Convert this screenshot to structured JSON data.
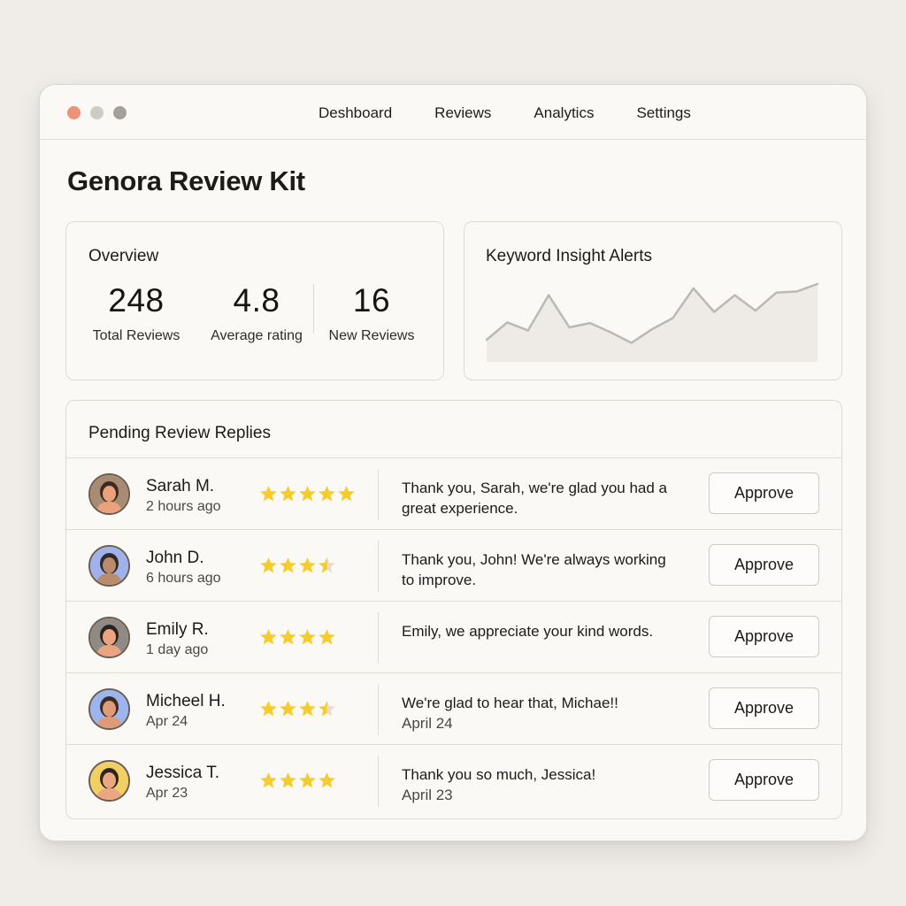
{
  "nav": {
    "items": [
      "Deshboard",
      "Reviews",
      "Analytics",
      "Settings"
    ]
  },
  "page": {
    "title": "Genora Review Kit"
  },
  "overview": {
    "title": "Overview",
    "stats": [
      {
        "value": "248",
        "label": "Total Reviews"
      },
      {
        "value": "4.8",
        "label": "Average rating"
      },
      {
        "value": "16",
        "label": "New Reviews"
      }
    ]
  },
  "insights": {
    "title": "Keyword Insight Alerts",
    "trend": [
      0.1,
      0.38,
      0.25,
      0.82,
      0.3,
      0.37,
      0.22,
      0.05,
      0.27,
      0.45,
      0.93,
      0.55,
      0.82,
      0.57,
      0.86,
      0.88,
      1.0
    ]
  },
  "pending": {
    "title": "Pending Review Replies",
    "approve_label": "Approve",
    "rows": [
      {
        "name": "Sarah M.",
        "time": "2 hours ago",
        "rating": 5,
        "reply": "Thank you, Sarah, we're glad you had a great experience.",
        "reply_date": "",
        "avatar_bg": "#a98a73",
        "skin": "#e9a27c",
        "hair": "#3b2b22"
      },
      {
        "name": "John D.",
        "time": "6 hours ago",
        "rating": 3.5,
        "reply": "Thank you, John! We're always working to improve.",
        "reply_date": "",
        "avatar_bg": "#9fb2ec",
        "skin": "#b98c6b",
        "hair": "#2f2a28"
      },
      {
        "name": "Emily R.",
        "time": "1 day ago",
        "rating": 4,
        "reply": "Emily, we appreciate your kind words.",
        "reply_date": "",
        "avatar_bg": "#8f8a84",
        "skin": "#eaa47f",
        "hair": "#2b2320"
      },
      {
        "name": "Micheel H.",
        "time": "Apr 24",
        "rating": 3.5,
        "reply": "We're glad to hear that, Michae!!",
        "reply_date": "April 24",
        "avatar_bg": "#9cb5ee",
        "skin": "#dd9b78",
        "hair": "#3a2c24"
      },
      {
        "name": "Jessica T.",
        "time": "Apr 23",
        "rating": 4,
        "reply": "Thank you so much, Jessica!",
        "reply_date": "April 23",
        "avatar_bg": "#f2cf63",
        "skin": "#eba682",
        "hair": "#2d2420"
      }
    ]
  },
  "colors": {
    "star": "#f6cc2c",
    "accent_red": "#eb9379",
    "background": "#f0ede8"
  }
}
